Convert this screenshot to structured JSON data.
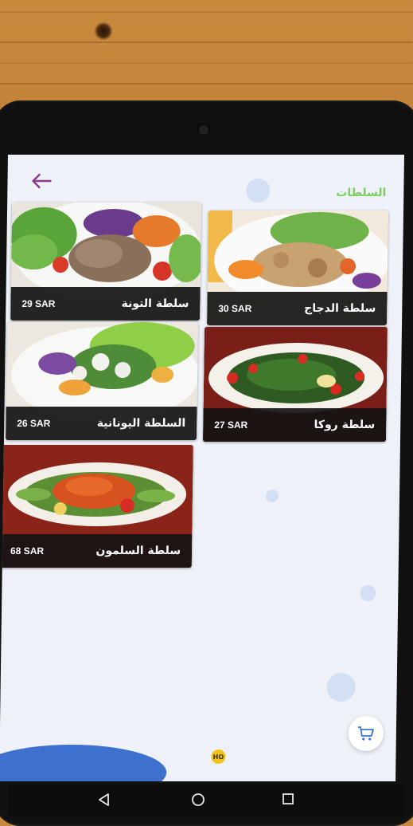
{
  "header": {
    "title": "السلطات",
    "back_icon": "arrow-left-icon"
  },
  "colors": {
    "title_green": "#7ccf5c",
    "back_purple": "#8b3a8f",
    "card_bar": "#141414",
    "cart_blue": "#3b74d6"
  },
  "menu": {
    "items": [
      {
        "name": "سلطة التونة",
        "price": "29 SAR",
        "image": "tuna-salad-photo"
      },
      {
        "name": "سلطة الدجاج",
        "price": "30 SAR",
        "image": "chicken-salad-photo"
      },
      {
        "name": "السلطة اليونانية",
        "price": "26 SAR",
        "image": "greek-salad-photo"
      },
      {
        "name": "سلطة روكا",
        "price": "27 SAR",
        "image": "rocca-salad-photo"
      },
      {
        "name": "سلطة السلمون",
        "price": "68 SAR",
        "image": "salmon-salad-photo"
      }
    ]
  },
  "floating": {
    "cart_icon": "shopping-cart-icon",
    "logo_text": "HO"
  },
  "system_nav": {
    "back": "nav-back-icon",
    "home": "nav-home-icon",
    "recents": "nav-recents-icon"
  }
}
